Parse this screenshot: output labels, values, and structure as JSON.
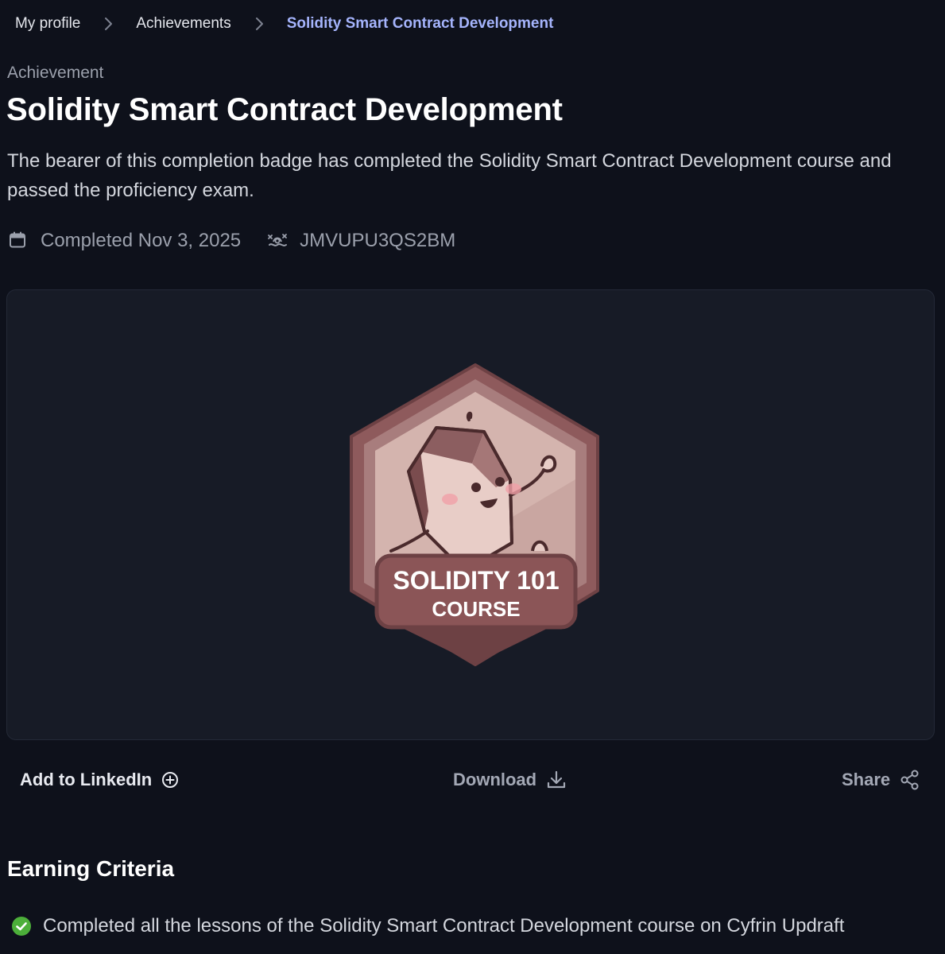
{
  "breadcrumb": {
    "items": [
      "My profile",
      "Achievements",
      "Solidity Smart Contract Development"
    ]
  },
  "header": {
    "eyebrow": "Achievement",
    "title": "Solidity Smart Contract Development",
    "description": "The bearer of this completion badge has completed the Solidity Smart Contract Development course and passed the proficiency exam."
  },
  "meta": {
    "completed": "Completed Nov 3, 2025",
    "completed_icon": "calendar-icon",
    "credential_id": "JMVUPU3QS2BM",
    "credential_icon": "id-hash-icon"
  },
  "badge": {
    "line1": "SOLIDITY 101",
    "line2": "COURSE",
    "colors": {
      "outer": "#8e5a5c",
      "rim": "#a87d7d",
      "inner": "#c9a6a1",
      "banner": "#8b5557",
      "ink": "#4a2a2c"
    }
  },
  "actions": {
    "linkedin": "Add to LinkedIn",
    "download": "Download",
    "share": "Share"
  },
  "criteria": {
    "title": "Earning Criteria",
    "items": [
      "Completed all the lessons of the Solidity Smart Contract Development course on Cyfrin Updraft"
    ]
  },
  "colors": {
    "background": "#0e111b",
    "accent": "#a5b4fc",
    "success": "#4caf3a"
  }
}
